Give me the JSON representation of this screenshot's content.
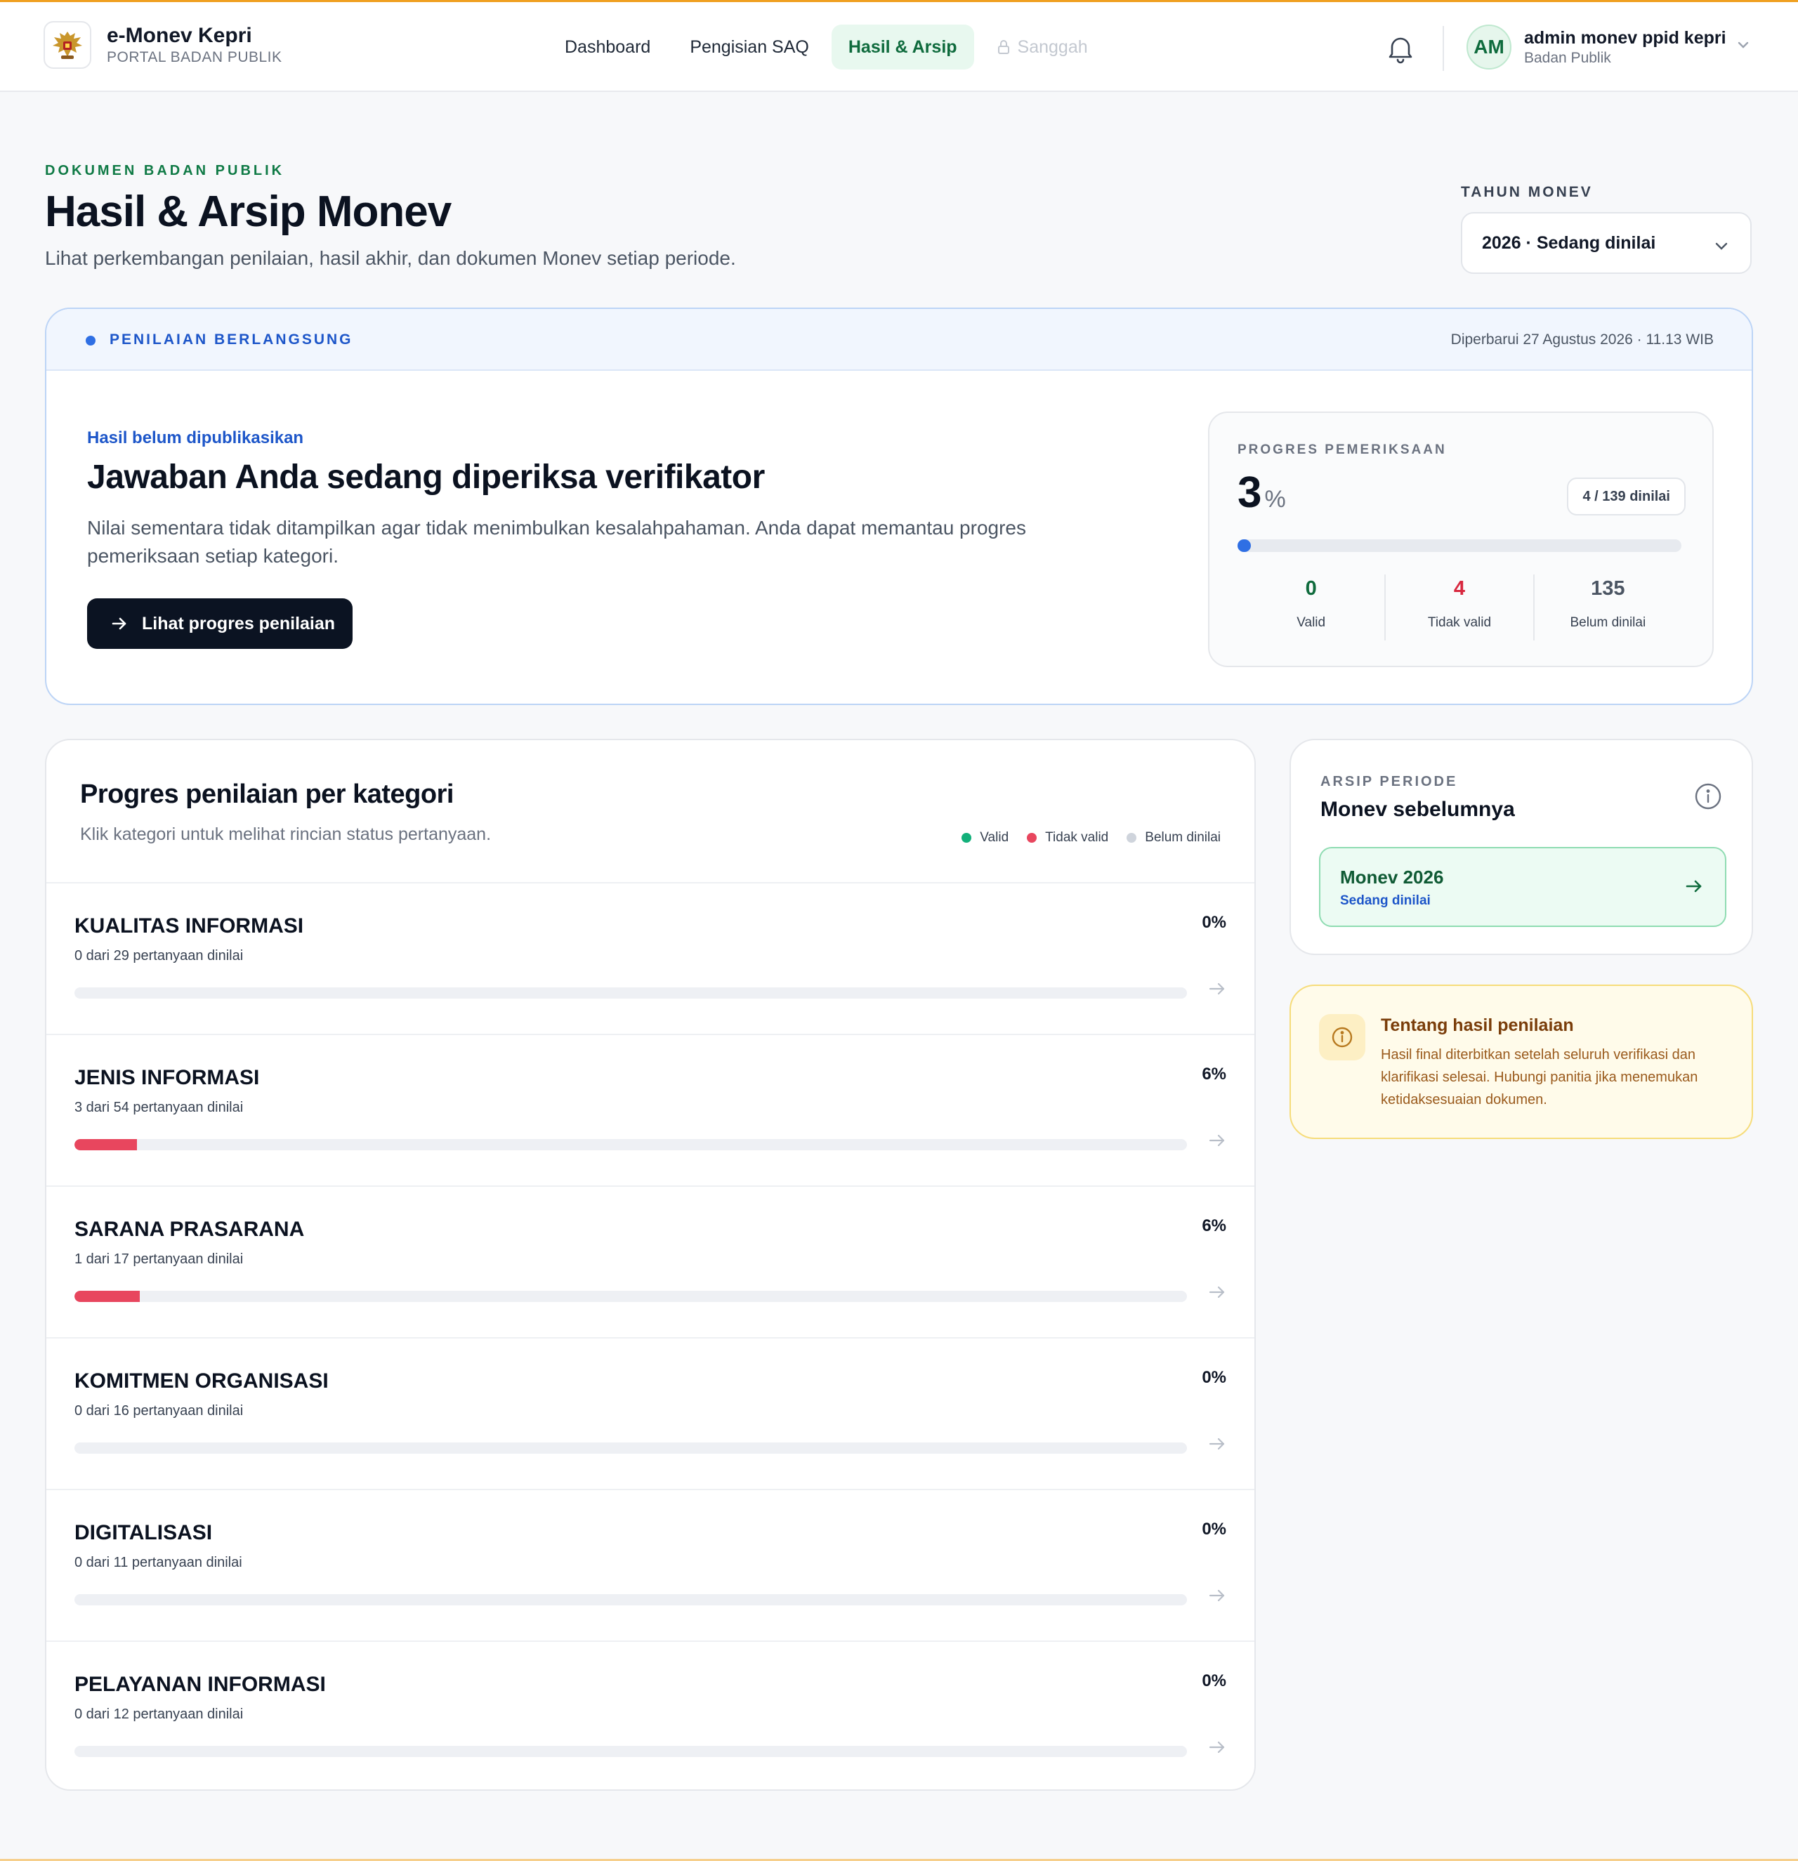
{
  "header": {
    "brand_title": "e-Monev Kepri",
    "brand_subtitle": "PORTAL BADAN PUBLIK",
    "nav": [
      {
        "label": "Dashboard",
        "state": "default"
      },
      {
        "label": "Pengisian SAQ",
        "state": "default"
      },
      {
        "label": "Hasil & Arsip",
        "state": "active"
      },
      {
        "label": "Sanggah",
        "state": "disabled",
        "icon": "lock-icon"
      }
    ],
    "user": {
      "initials": "AM",
      "name": "admin monev ppid kepri",
      "role": "Badan Publik"
    }
  },
  "page": {
    "eyebrow": "DOKUMEN BADAN PUBLIK",
    "title": "Hasil & Arsip Monev",
    "description": "Lihat perkembangan penilaian, hasil akhir, dan dokumen Monev setiap periode.",
    "year_label": "TAHUN MONEV",
    "year_value": "2026 · Sedang dinilai"
  },
  "status": {
    "live_label": "PENILAIAN BERLANGSUNG",
    "updated": "Diperbarui 27 Agustus 2026 · 11.13 WIB",
    "unpublished": "Hasil belum dipublikasikan",
    "title": "Jawaban Anda sedang diperiksa verifikator",
    "description": "Nilai sementara tidak ditampilkan agar tidak menimbulkan kesalahpahaman. Anda dapat memantau progres pemeriksaan setiap kategori.",
    "button_label": "Lihat progres penilaian",
    "progress": {
      "label": "PROGRES PEMERIKSAAN",
      "value": "3",
      "unit": "%",
      "fraction": 0.03,
      "badge": "4 / 139 dinilai",
      "stats": [
        {
          "num": "0",
          "label": "Valid",
          "color": "#0f6b3d"
        },
        {
          "num": "4",
          "label": "Tidak valid",
          "color": "#d8283f"
        },
        {
          "num": "135",
          "label": "Belum dinilai",
          "color": "#4b5563"
        }
      ]
    }
  },
  "categories": {
    "title": "Progres penilaian per kategori",
    "subtitle": "Klik kategori untuk melihat rincian status pertanyaan.",
    "legend": [
      {
        "label": "Valid",
        "color": "#12b07a"
      },
      {
        "label": "Tidak valid",
        "color": "#e8465e"
      },
      {
        "label": "Belum dinilai",
        "color": "#cfd4dc"
      }
    ],
    "items": [
      {
        "name": "KUALITAS INFORMASI",
        "count": "0 dari 29 pertanyaan dinilai",
        "percent": "0%",
        "invalid_fraction": 0
      },
      {
        "name": "JENIS INFORMASI",
        "count": "3 dari 54 pertanyaan dinilai",
        "percent": "6%",
        "invalid_fraction": 0.056
      },
      {
        "name": "SARANA PRASARANA",
        "count": "1 dari 17 pertanyaan dinilai",
        "percent": "6%",
        "invalid_fraction": 0.059
      },
      {
        "name": "KOMITMEN ORGANISASI",
        "count": "0 dari 16 pertanyaan dinilai",
        "percent": "0%",
        "invalid_fraction": 0
      },
      {
        "name": "DIGITALISASI",
        "count": "0 dari 11 pertanyaan dinilai",
        "percent": "0%",
        "invalid_fraction": 0
      },
      {
        "name": "PELAYANAN INFORMASI",
        "count": "0 dari 12 pertanyaan dinilai",
        "percent": "0%",
        "invalid_fraction": 0
      }
    ]
  },
  "archive": {
    "label": "ARSIP PERIODE",
    "title": "Monev sebelumnya",
    "items": [
      {
        "title": "Monev 2026",
        "status": "Sedang dinilai"
      }
    ]
  },
  "about": {
    "title": "Tentang hasil penilaian",
    "text": "Hasil final diterbitkan setelah seluruh verifikasi dan klarifikasi selesai. Hubungi panitia jika menemukan ketidaksesuaian dokumen."
  }
}
